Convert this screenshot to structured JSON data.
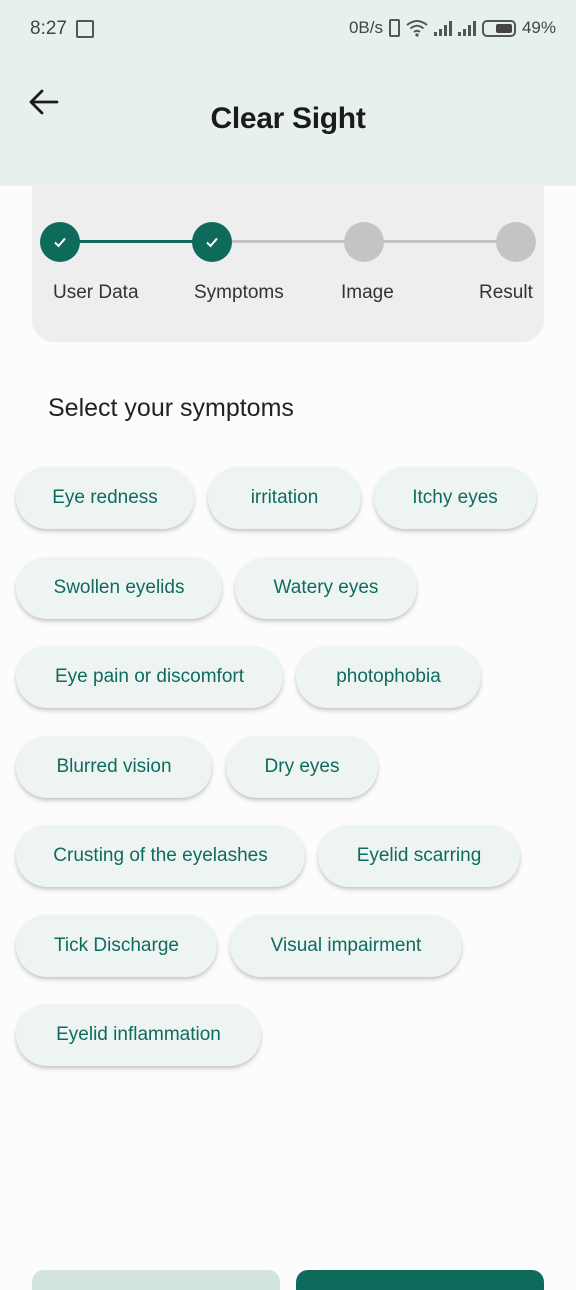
{
  "status_bar": {
    "time": "8:27",
    "net_speed": "0B/s",
    "battery": "49%"
  },
  "app_bar": {
    "title": "Clear Sight"
  },
  "stepper": {
    "steps": [
      {
        "label": "User Data",
        "state": "done"
      },
      {
        "label": "Symptoms",
        "state": "done"
      },
      {
        "label": "Image",
        "state": "todo"
      },
      {
        "label": "Result",
        "state": "todo"
      }
    ]
  },
  "symptoms_section": {
    "title": "Select your symptoms",
    "chips": [
      "Eye redness",
      "irritation",
      "Itchy eyes",
      "Swollen eyelids",
      "Watery eyes",
      "Eye pain or discomfort",
      "photophobia",
      "Blurred vision",
      "Dry eyes",
      "Crusting of the eyelashes",
      "Eyelid scarring",
      "Tick Discharge",
      "Visual impairment",
      "Eyelid inflammation"
    ]
  },
  "colors": {
    "accent": "#0e6b5c",
    "chip_text": "#0f6b5e",
    "header_bg": "#e6f0ec"
  }
}
